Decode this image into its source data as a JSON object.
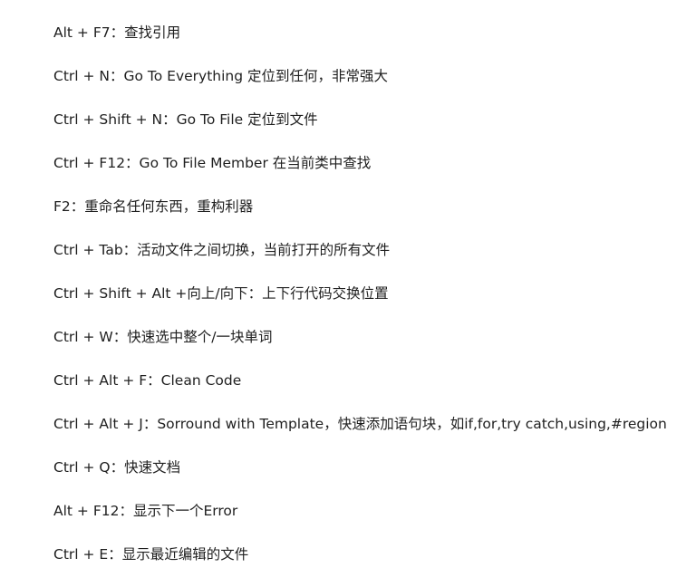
{
  "shortcuts": [
    "Alt + F7：查找引用",
    "Ctrl + N：Go To Everything 定位到任何，非常强大",
    "Ctrl + Shift + N：Go To File 定位到文件",
    "Ctrl + F12：Go To File Member 在当前类中查找",
    "F2：重命名任何东西，重构利器",
    "Ctrl + Tab：活动文件之间切换，当前打开的所有文件",
    "Ctrl + Shift + Alt +向上/向下：上下行代码交换位置",
    "Ctrl + W：快速选中整个/一块单词",
    "Ctrl + Alt + F：Clean Code",
    "Ctrl + Alt + J：Sorround with Template，快速添加语句块，如if,for,try catch,using,#region",
    "Ctrl + Q：快速文档",
    "Alt + F12：显示下一个Error",
    "Ctrl + E：显示最近编辑的文件"
  ]
}
